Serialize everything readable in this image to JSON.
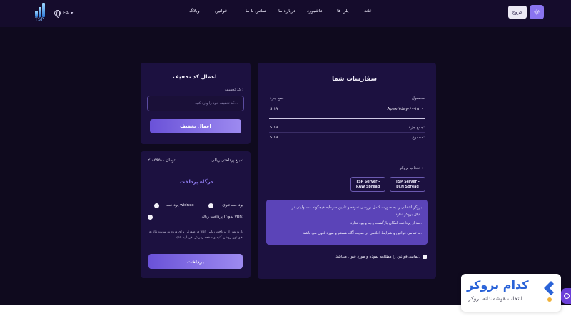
{
  "header": {
    "logo_text": "TSP",
    "lang": "FA",
    "nav": [
      "خانه",
      "پلن ها",
      "داشبورد",
      "درباره ما",
      "تماس با ما",
      "قوانین",
      "وبلاگ"
    ],
    "exit_label": "خروج"
  },
  "orders": {
    "title": "سفارشات شما",
    "col_product": "محصول",
    "col_subtotal": "جمع جزء",
    "product_name": "Apex-۷day-۶۰-۱۵۰۰",
    "product_price": "$ ۱۹",
    "subtotal_label": "جمع جزء:",
    "subtotal_value": "$ ۱۹",
    "total_label": "مجموع:",
    "total_value": "$ ۱۹",
    "broker_label": "انتخاب بروکر :",
    "brokers": [
      {
        "line1": "TSP Server -",
        "line2": "ECN Spread"
      },
      {
        "line1": "TSP Server -",
        "line2": "RAW Spread"
      }
    ],
    "notice": [
      "بروکر انتخابی را به صورت کامل بررسی نموده و تامین سرمایه هیچگونه مسئولیتی در",
      "قبال بروکر ندارد.",
      "بعد از پرداخت امکان بازگشت وجه وجود ندارد.",
      "به تمامی قوانین و شرایط اعلامی در سایت آگاه هستم و مورد قبول می باشد."
    ],
    "terms": "تمامی قوانین را مطالعه نموده و مورد قبول میباشد."
  },
  "discount": {
    "title": "اعمال کد تخفیف",
    "field_label": "کد تخفیف :",
    "placeholder": "کد تخفیف خود را وارد کنید...",
    "apply_label": "اعمال تخفیف"
  },
  "payment": {
    "amount_label": "مبلغ پرداختی ریالی:",
    "amount_value": "۲۱۸۵۹۵۰۰ تومان",
    "gateway_title": "درگاه پرداخت",
    "opt_tether": "پرداخت تتری",
    "opt_widnex": "پرداخت widnex",
    "opt_rial": "پرداخت ریالی (بدون vpn)",
    "note_line1": "در صورتی برای ورود به سایت نیاز به vpn دارید پس از پرداخت ریالی",
    "note_line2": "vpn خودتون روشن کنید و صفحه رفرش بفرمایید.",
    "pay_label": "پرداخت"
  },
  "ad": {
    "title": "کدام بروکر",
    "subtitle": "انتخاب هوشمندانه بروکر"
  }
}
